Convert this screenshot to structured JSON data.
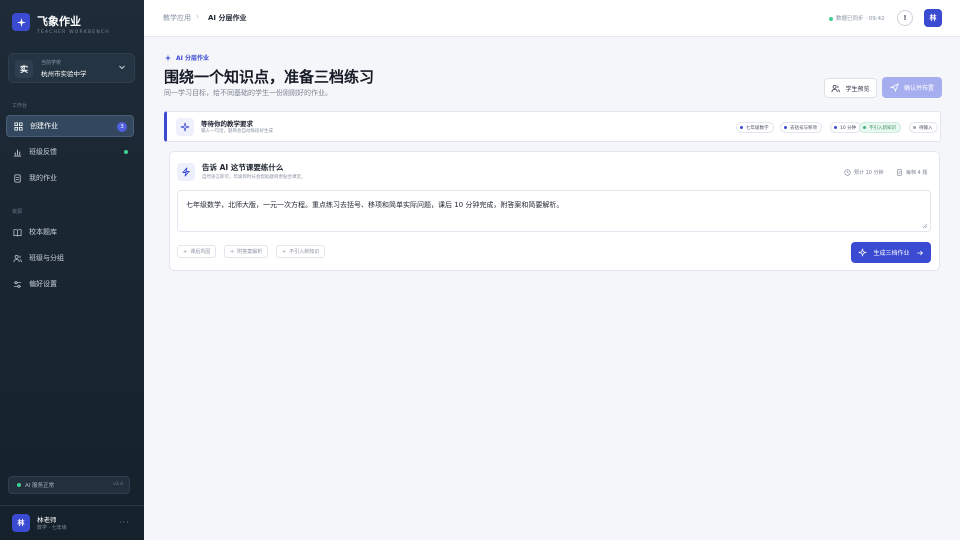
{
  "app": {
    "title": "飞象作业",
    "subtitle": "TEACHER WORKBENCH"
  },
  "school": {
    "label": "当前学校",
    "name": "杭州市实验中学",
    "avatar": "实"
  },
  "sidebar": {
    "section1": "工作台",
    "items": [
      {
        "label": "创建作业",
        "icon": "grid-icon",
        "badge": "3"
      },
      {
        "label": "班级反馈",
        "icon": "bar-chart-icon"
      },
      {
        "label": "我的作业",
        "icon": "document-icon"
      }
    ],
    "section2": "资源",
    "items2": [
      {
        "label": "校本题库",
        "icon": "book-icon"
      },
      {
        "label": "班级与分组",
        "icon": "users-icon"
      },
      {
        "label": "偏好设置",
        "icon": "sliders-icon"
      }
    ],
    "status": {
      "text": "AI 服务正常",
      "version": "v2.4"
    }
  },
  "user": {
    "name": "林老师",
    "role": "数学 · 七年级",
    "avatar": "林"
  },
  "header": {
    "breadcrumb": [
      "教学应用",
      "AI 分层作业"
    ],
    "sync": "数据已同步 · 09:42",
    "alert": "!",
    "avatar": "林"
  },
  "page": {
    "eyebrow": "AI  分层作业",
    "title": "围绕一个知识点，准备三档练习",
    "subtitle": "同一学习目标，给不同基础的学生一份刚刚好的作业。",
    "preview_btn": "学生预览",
    "publish_btn": "确认并布置"
  },
  "waiting": {
    "title": "等待你的教学要求",
    "desc": "输入一句话，题目会自动每段好生成",
    "chips": [
      "七年级数学",
      "去括号与移项",
      "10 分钟",
      "不引入新知识",
      "待输入"
    ]
  },
  "composer": {
    "title": "告诉 AI 这节课要练什么",
    "desc": "自然语言即可，年级和时长会帮助题目更贴合课堂。",
    "estimate": "预计 10 分钟",
    "count": "每档 4 题",
    "text": "七年级数学，北师大版，一元一次方程。重点练习去括号、移项和简单实际问题，课后 10 分钟完成，附答案和简要解析。",
    "options": [
      "课后巩固",
      "附答案解析",
      "不引入新知识"
    ],
    "generate_btn": "生成三档作业"
  },
  "colors": {
    "accent": "#3b4bd1",
    "sidebar": "#1e2b38",
    "ok": "#3fd18f"
  }
}
